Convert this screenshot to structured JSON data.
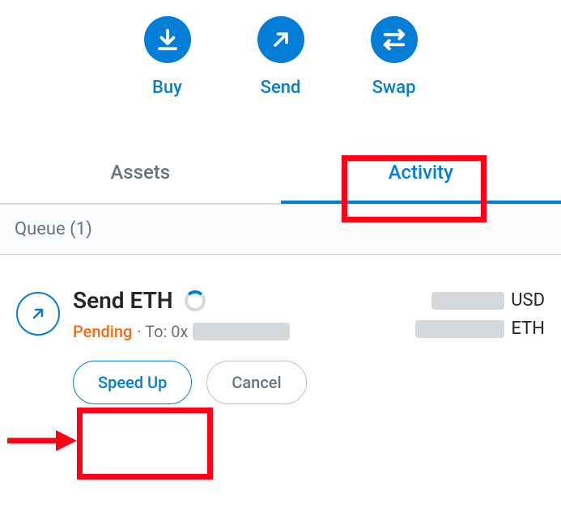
{
  "actions": {
    "buy": {
      "label": "Buy",
      "icon": "download-icon"
    },
    "send": {
      "label": "Send",
      "icon": "arrow-up-right-icon"
    },
    "swap": {
      "label": "Swap",
      "icon": "swap-icon"
    }
  },
  "tabs": {
    "assets": {
      "label": "Assets",
      "active": false
    },
    "activity": {
      "label": "Activity",
      "active": true
    }
  },
  "queue": {
    "label": "Queue (1)"
  },
  "transaction": {
    "title": "Send ETH",
    "status": "Pending",
    "to_prefix": "· To: 0x",
    "fiat_currency": "USD",
    "crypto_currency": "ETH"
  },
  "tx_buttons": {
    "speed_up": "Speed Up",
    "cancel": "Cancel"
  }
}
